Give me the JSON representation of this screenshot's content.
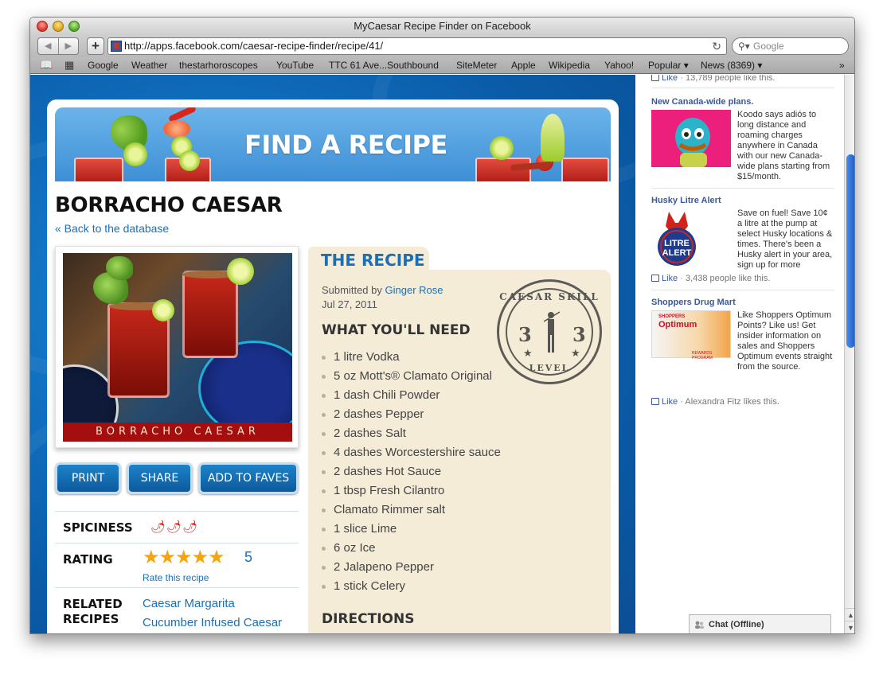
{
  "window": {
    "title": "MyCaesar Recipe Finder on Facebook"
  },
  "toolbar": {
    "back_icon": "back-arrow-icon",
    "forward_icon": "forward-arrow-icon",
    "add_label": "+",
    "url": "http://apps.facebook.com/caesar-recipe-finder/recipe/41/",
    "reload_icon": "reload-icon",
    "search_placeholder": "Google"
  },
  "bookmarks": {
    "items": [
      "Google",
      "Weather",
      "thestarhoroscopes",
      "YouTube",
      "TTC 61 Ave...Southbound",
      "SiteMeter",
      "Apple",
      "Wikipedia",
      "Yahoo!",
      "Popular ▾",
      "News (8369) ▾"
    ],
    "overflow": "»"
  },
  "app": {
    "banner_title": "FIND A RECIPE",
    "recipe_title": "BORRACHO CAESAR",
    "back_link": "« Back to the database",
    "photo_caption": "BORRACHO CAESAR",
    "buttons": {
      "print": "PRINT",
      "share": "SHARE",
      "add_to_faves": "ADD TO FAVES"
    },
    "spiciness": {
      "label": "SPICINESS",
      "level": 3,
      "max": 3,
      "icons": "🌶🌶🌶"
    },
    "rating": {
      "label": "RATING",
      "value": 5,
      "max": 5,
      "stars": "★★★★★",
      "number": "5",
      "rate_link": "Rate this recipe"
    },
    "related": {
      "label_line1": "RELATED",
      "label_line2": "RECIPES",
      "items": [
        "Caesar Margarita",
        "Cucumber Infused Caesar"
      ]
    }
  },
  "recipe": {
    "tab_title": "THE RECIPE",
    "submitted_by_prefix": "Submitted by",
    "author": "Ginger Rose",
    "date": "Jul 27, 2011",
    "needs_heading": "WHAT YOU'LL NEED",
    "ingredients": [
      "1 litre Vodka",
      "5 oz Mott's® Clamato Original",
      "1 dash Chili Powder",
      "2 dashes Pepper",
      "2 dashes Salt",
      "4 dashes Worcestershire sauce",
      "2 dashes Hot Sauce",
      "1 tbsp Fresh Cilantro",
      "Clamato Rimmer salt",
      "1 slice Lime",
      "6 oz Ice",
      "2 Jalapeno Pepper",
      "1 stick Celery"
    ],
    "directions_heading": "DIRECTIONS",
    "stamp": {
      "top_text": "CAESAR SKILL",
      "bottom_text": "LEVEL",
      "left_number": "3",
      "right_number": "3"
    }
  },
  "sidebar": {
    "top_like": {
      "like_label": "Like",
      "text": " · 13,789 people like this."
    },
    "ads": [
      {
        "title": "New Canada-wide plans.",
        "text": "Koodo says adiós to long distance and roaming charges anywhere in Canada with our new Canada-wide plans starting from $15/month."
      },
      {
        "title": "Husky Litre Alert",
        "text": "Save on fuel! Save 10¢ a litre at the pump at select Husky locations & times. There's been a Husky alert in your area, sign up for more",
        "image_line1": "LITRE",
        "image_line2": "ALERT",
        "like_label": "Like",
        "like_text": " · 3,438 people like this."
      },
      {
        "title": "Shoppers Drug Mart",
        "text": "Like Shoppers Optimum Points? Like us! Get insider information on sales and Shoppers Optimum events straight from the source.",
        "image_brand": "SHOPPERS",
        "image_title": "Optimum",
        "image_sub": "REWARDS PROGRAM",
        "like_label": "Like",
        "like_text": " · Alexandra Fitz likes this."
      }
    ]
  },
  "chat": {
    "label": "Chat (Offline)"
  },
  "colors": {
    "link_blue": "#1a6fb5",
    "facebook_blue": "#3b5998",
    "recipe_panel": "#f4ecd7",
    "caption_red": "#a50e0e"
  }
}
